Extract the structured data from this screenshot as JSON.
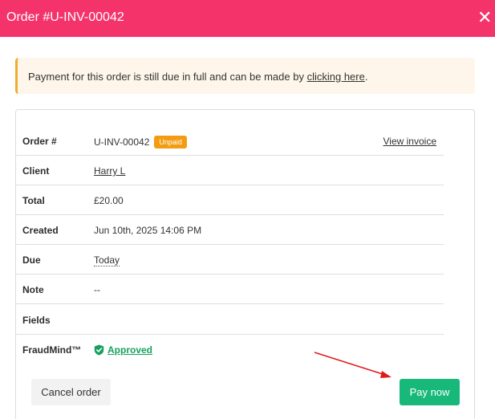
{
  "modal": {
    "title": "Order #U-INV-00042",
    "close_glyph": "✕"
  },
  "alert": {
    "text_before": "Payment for this order is still due in full and can be made by ",
    "link": "clicking here",
    "text_after": "."
  },
  "details": {
    "order": {
      "label": "Order #",
      "value": "U-INV-00042",
      "badge": "Unpaid",
      "action": "View invoice"
    },
    "client": {
      "label": "Client",
      "value": "Harry L"
    },
    "total": {
      "label": "Total",
      "value": "£20.00"
    },
    "created": {
      "label": "Created",
      "value": "Jun 10th, 2025 14:06 PM"
    },
    "due": {
      "label": "Due",
      "value": "Today"
    },
    "note": {
      "label": "Note",
      "value": "--"
    },
    "fields": {
      "label": "Fields",
      "value": ""
    },
    "fraudmind": {
      "label": "FraudMind™",
      "value": "Approved",
      "icon": "shield-check-icon"
    }
  },
  "buttons": {
    "cancel": "Cancel order",
    "pay": "Pay now"
  },
  "colors": {
    "header": "#f5336b",
    "alert_border": "#f0ac2e",
    "alert_bg": "#fef6ea",
    "badge": "#f39c12",
    "approved": "#16a05d",
    "pay_button": "#17b87a",
    "annotation_arrow": "#e01a1a"
  }
}
